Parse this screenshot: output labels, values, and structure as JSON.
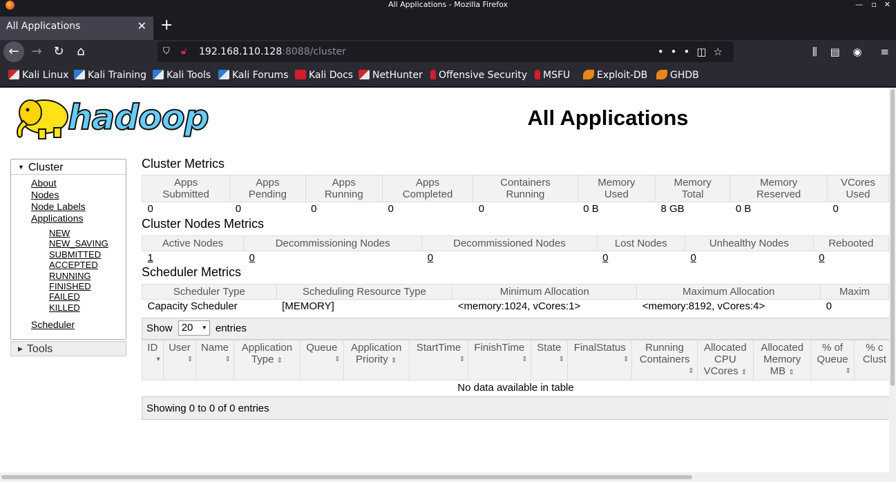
{
  "window": {
    "title": "All Applications - Mozilla Firefox",
    "controls": [
      "—",
      "▫",
      "✕"
    ]
  },
  "tab": {
    "label": "All Applications",
    "close": "✕",
    "new": "+"
  },
  "nav": {
    "back": "←",
    "forward": "→",
    "reload": "↻",
    "home": "⌂"
  },
  "urlbar": {
    "host": "192.168.110.128",
    "rest": ":8088/cluster",
    "more": "•••",
    "pocket": "◫",
    "star": "☆"
  },
  "toolbar_icons": {
    "library": "⫼",
    "sidebar": "▤",
    "account": "◉",
    "menu": "≡"
  },
  "bookmarks": [
    {
      "label": "Kali Linux",
      "icon": "kali"
    },
    {
      "label": "Kali Training",
      "icon": "kblue"
    },
    {
      "label": "Kali Tools",
      "icon": "kblue"
    },
    {
      "label": "Kali Forums",
      "icon": "kblue"
    },
    {
      "label": "Kali Docs",
      "icon": "doc"
    },
    {
      "label": "NetHunter",
      "icon": "kali"
    },
    {
      "label": "Offensive Security",
      "icon": "offsec"
    },
    {
      "label": "MSFU",
      "icon": "offsec"
    },
    {
      "label": "Exploit-DB",
      "icon": "exploit"
    },
    {
      "label": "GHDB",
      "icon": "exploit"
    }
  ],
  "logo": {
    "text": "hadoop"
  },
  "page_title": "All Applications",
  "sidebar": {
    "cluster_label": "Cluster",
    "links": [
      "About",
      "Nodes",
      "Node Labels",
      "Applications"
    ],
    "app_states": [
      "NEW",
      "NEW_SAVING",
      "SUBMITTED",
      "ACCEPTED",
      "RUNNING",
      "FINISHED",
      "FAILED",
      "KILLED"
    ],
    "scheduler": "Scheduler",
    "tools_label": "Tools"
  },
  "cluster_metrics": {
    "title": "Cluster Metrics",
    "headers": [
      [
        "Apps",
        "Submitted"
      ],
      [
        "Apps",
        "Pending"
      ],
      [
        "Apps",
        "Running"
      ],
      [
        "Apps",
        "Completed"
      ],
      [
        "Containers",
        "Running"
      ],
      [
        "Memory",
        "Used"
      ],
      [
        "Memory",
        "Total"
      ],
      [
        "Memory",
        "Reserved"
      ],
      [
        "VCores",
        "Used"
      ]
    ],
    "values": [
      "0",
      "0",
      "0",
      "0",
      "0",
      "0 B",
      "8 GB",
      "0 B",
      "0"
    ]
  },
  "nodes_metrics": {
    "title": "Cluster Nodes Metrics",
    "headers": [
      "Active Nodes",
      "Decommissioning Nodes",
      "Decommissioned Nodes",
      "Lost Nodes",
      "Unhealthy Nodes",
      "Rebooted"
    ],
    "values": [
      "1",
      "0",
      "0",
      "0",
      "0",
      "0"
    ]
  },
  "scheduler_metrics": {
    "title": "Scheduler Metrics",
    "headers": [
      "Scheduler Type",
      "Scheduling Resource Type",
      "Minimum Allocation",
      "Maximum Allocation",
      "Maxim"
    ],
    "values": [
      "Capacity Scheduler",
      "[MEMORY]",
      "<memory:1024, vCores:1>",
      "<memory:8192, vCores:4>",
      "0"
    ]
  },
  "apps_table": {
    "show_label": "Show",
    "page_size": "20",
    "entries_label": "entries",
    "columns": [
      [
        "ID"
      ],
      [
        "User"
      ],
      [
        "Name"
      ],
      [
        "Application",
        "Type"
      ],
      [
        "Queue"
      ],
      [
        "Application",
        "Priority"
      ],
      [
        "StartTime"
      ],
      [
        "FinishTime"
      ],
      [
        "State"
      ],
      [
        "FinalStatus"
      ],
      [
        "Running",
        "Containers"
      ],
      [
        "Allocated",
        "CPU",
        "VCores"
      ],
      [
        "Allocated",
        "Memory",
        "MB"
      ],
      [
        "% of",
        "Queue"
      ],
      [
        "% c",
        "Clust"
      ]
    ],
    "empty": "No data available in table",
    "footer": "Showing 0 to 0 of 0 entries"
  }
}
